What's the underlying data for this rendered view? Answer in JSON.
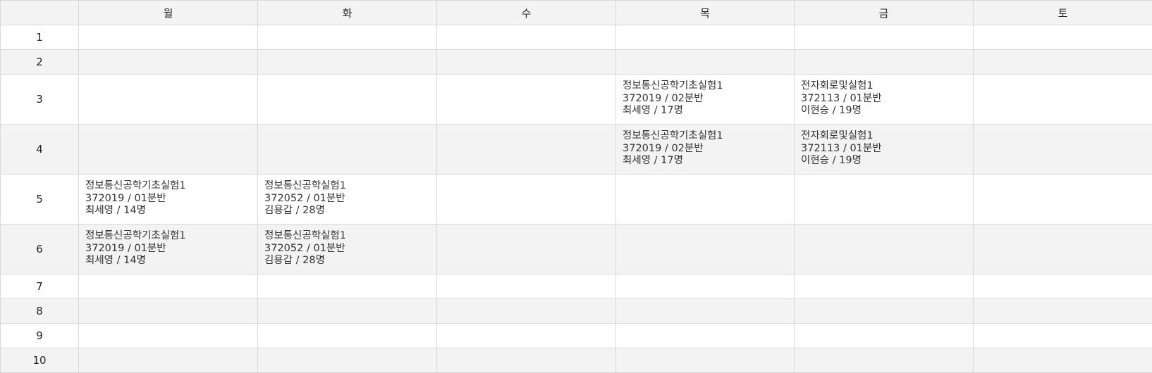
{
  "timetable": {
    "days": [
      "",
      "월",
      "화",
      "수",
      "목",
      "금",
      "토"
    ],
    "rows": [
      {
        "period": "1",
        "tall": false,
        "cells": [
          null,
          null,
          null,
          null,
          null,
          null
        ]
      },
      {
        "period": "2",
        "tall": false,
        "cells": [
          null,
          null,
          null,
          null,
          null,
          null
        ]
      },
      {
        "period": "3",
        "tall": true,
        "cells": [
          null,
          null,
          null,
          {
            "course": "정보통신공학기초실험1",
            "code": "372019 / 02분반",
            "info": "최세영 / 17명"
          },
          {
            "course": "전자회로및실험1",
            "code": "372113 / 01분반",
            "info": "이현승 / 19명"
          },
          null
        ]
      },
      {
        "period": "4",
        "tall": true,
        "cells": [
          null,
          null,
          null,
          {
            "course": "정보통신공학기초실험1",
            "code": "372019 / 02분반",
            "info": "최세영 / 17명"
          },
          {
            "course": "전자회로및실험1",
            "code": "372113 / 01분반",
            "info": "이현승 / 19명"
          },
          null
        ]
      },
      {
        "period": "5",
        "tall": true,
        "cells": [
          {
            "course": "정보통신공학기초실험1",
            "code": "372019 / 01분반",
            "info": "최세영 / 14명"
          },
          {
            "course": "정보통신공학실험1",
            "code": "372052 / 01분반",
            "info": "김용갑 / 28명"
          },
          null,
          null,
          null,
          null
        ]
      },
      {
        "period": "6",
        "tall": true,
        "cells": [
          {
            "course": "정보통신공학기초실험1",
            "code": "372019 / 01분반",
            "info": "최세영 / 14명"
          },
          {
            "course": "정보통신공학실험1",
            "code": "372052 / 01분반",
            "info": "김용갑 / 28명"
          },
          null,
          null,
          null,
          null
        ]
      },
      {
        "period": "7",
        "tall": false,
        "cells": [
          null,
          null,
          null,
          null,
          null,
          null
        ]
      },
      {
        "period": "8",
        "tall": false,
        "cells": [
          null,
          null,
          null,
          null,
          null,
          null
        ]
      },
      {
        "period": "9",
        "tall": false,
        "cells": [
          null,
          null,
          null,
          null,
          null,
          null
        ]
      },
      {
        "period": "10",
        "tall": false,
        "cells": [
          null,
          null,
          null,
          null,
          null,
          null
        ]
      }
    ]
  }
}
